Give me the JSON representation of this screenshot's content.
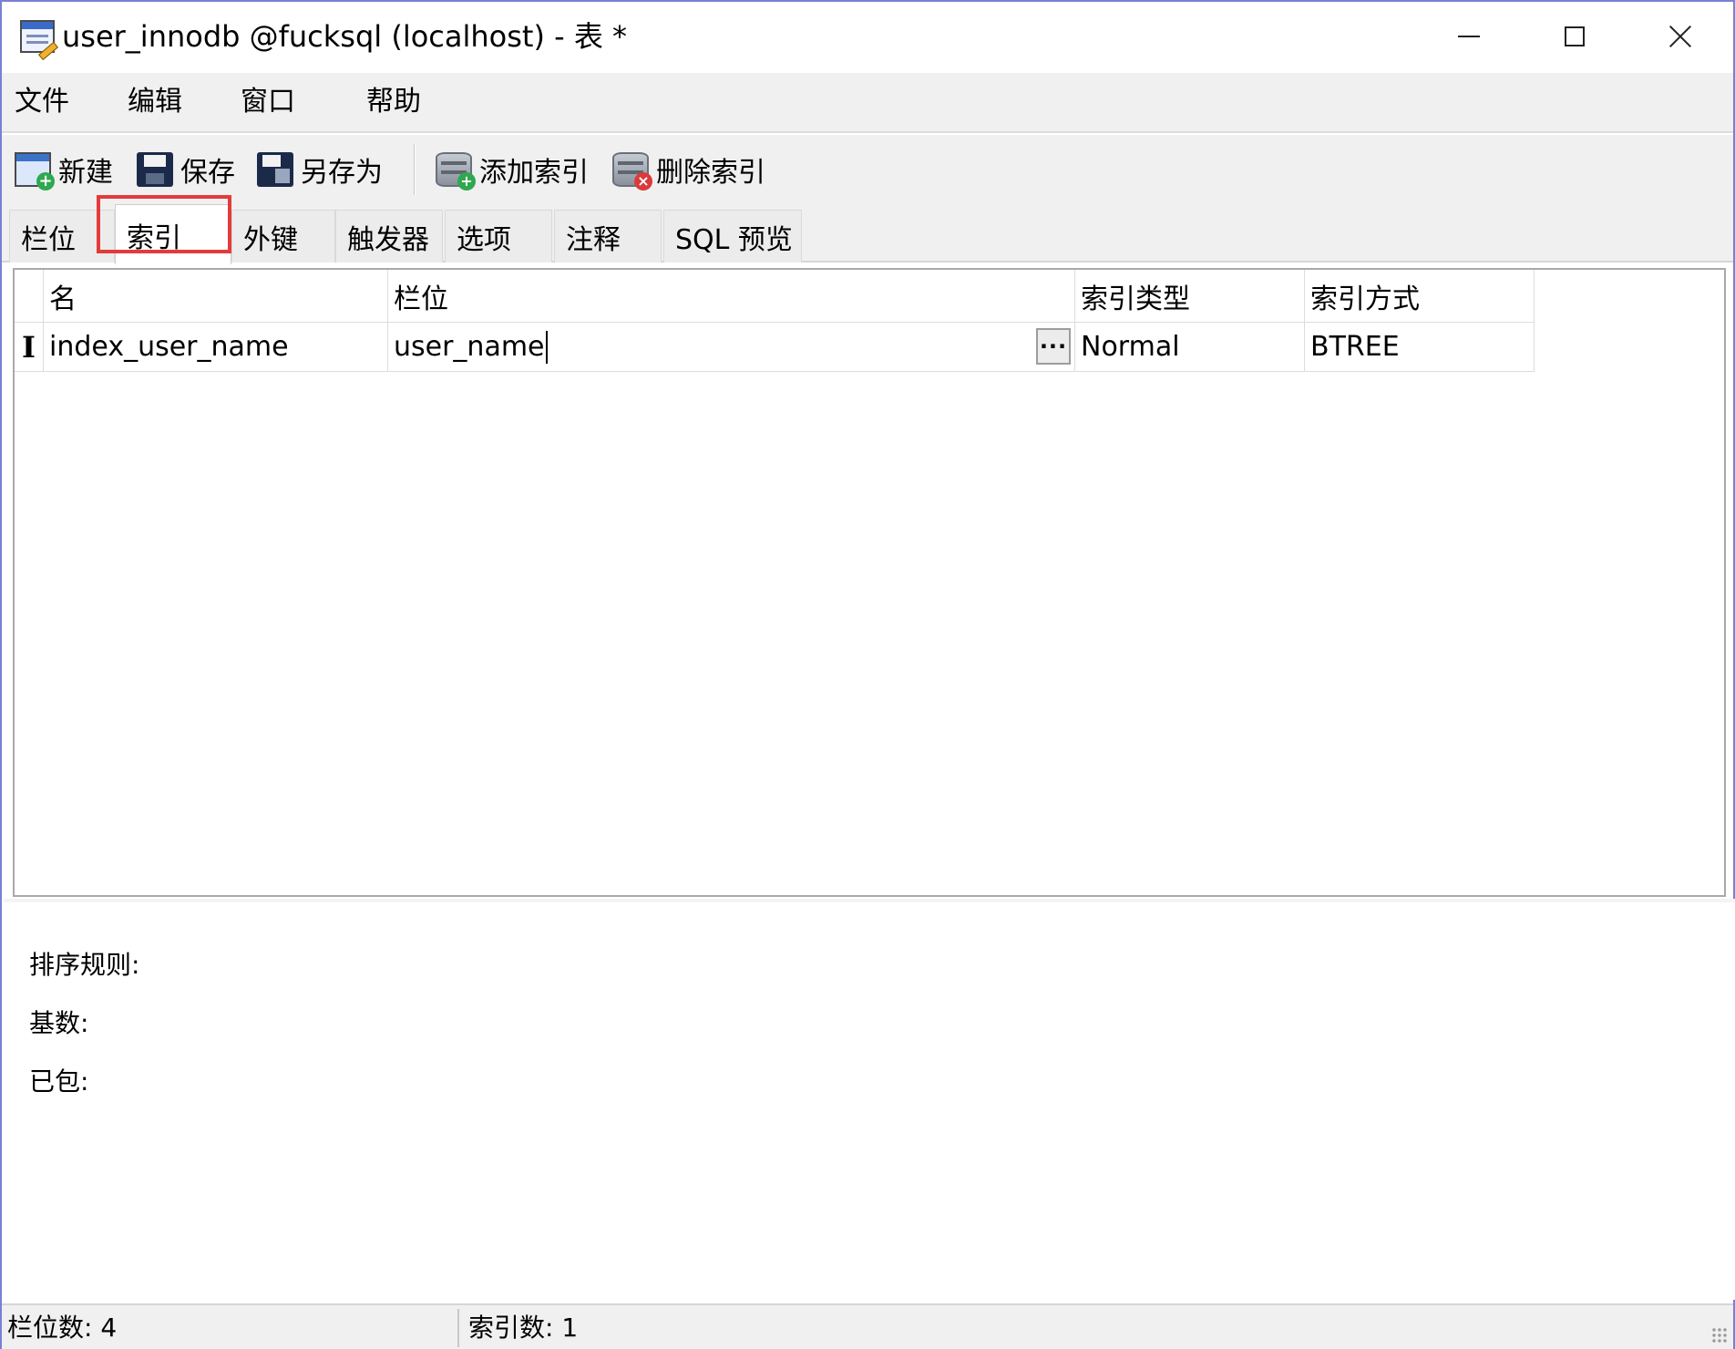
{
  "window": {
    "title": "user_innodb @fucksql (localhost) - 表 *"
  },
  "menu": {
    "items": [
      "文件",
      "编辑",
      "窗口",
      "帮助"
    ]
  },
  "toolbar": {
    "new": "新建",
    "save": "保存",
    "save_as": "另存为",
    "add_index": "添加索引",
    "delete_index": "删除索引"
  },
  "tabs": [
    "栏位",
    "索引",
    "外键",
    "触发器",
    "选项",
    "注释",
    "SQL 预览"
  ],
  "active_tab": "索引",
  "grid": {
    "columns": [
      "名",
      "栏位",
      "索引类型",
      "索引方式"
    ],
    "rows": [
      {
        "name": "index_user_name",
        "field": "user_name",
        "type": "Normal",
        "method": "BTREE"
      }
    ]
  },
  "properties": {
    "collation": "排序规则:",
    "cardinality": "基数:",
    "packed": "已包:"
  },
  "status": {
    "field_count": "栏位数: 4",
    "index_count": "索引数: 1"
  },
  "colors": {
    "highlight": "#e33b3b",
    "window_border": "#7a7fd6"
  },
  "icons": [
    "table-design-icon",
    "new-table-icon",
    "save-icon",
    "save-as-icon",
    "add-index-icon",
    "delete-index-icon",
    "minimize-icon",
    "maximize-icon",
    "close-icon",
    "text-cursor-icon",
    "ellipsis-icon",
    "resize-grip-icon"
  ]
}
